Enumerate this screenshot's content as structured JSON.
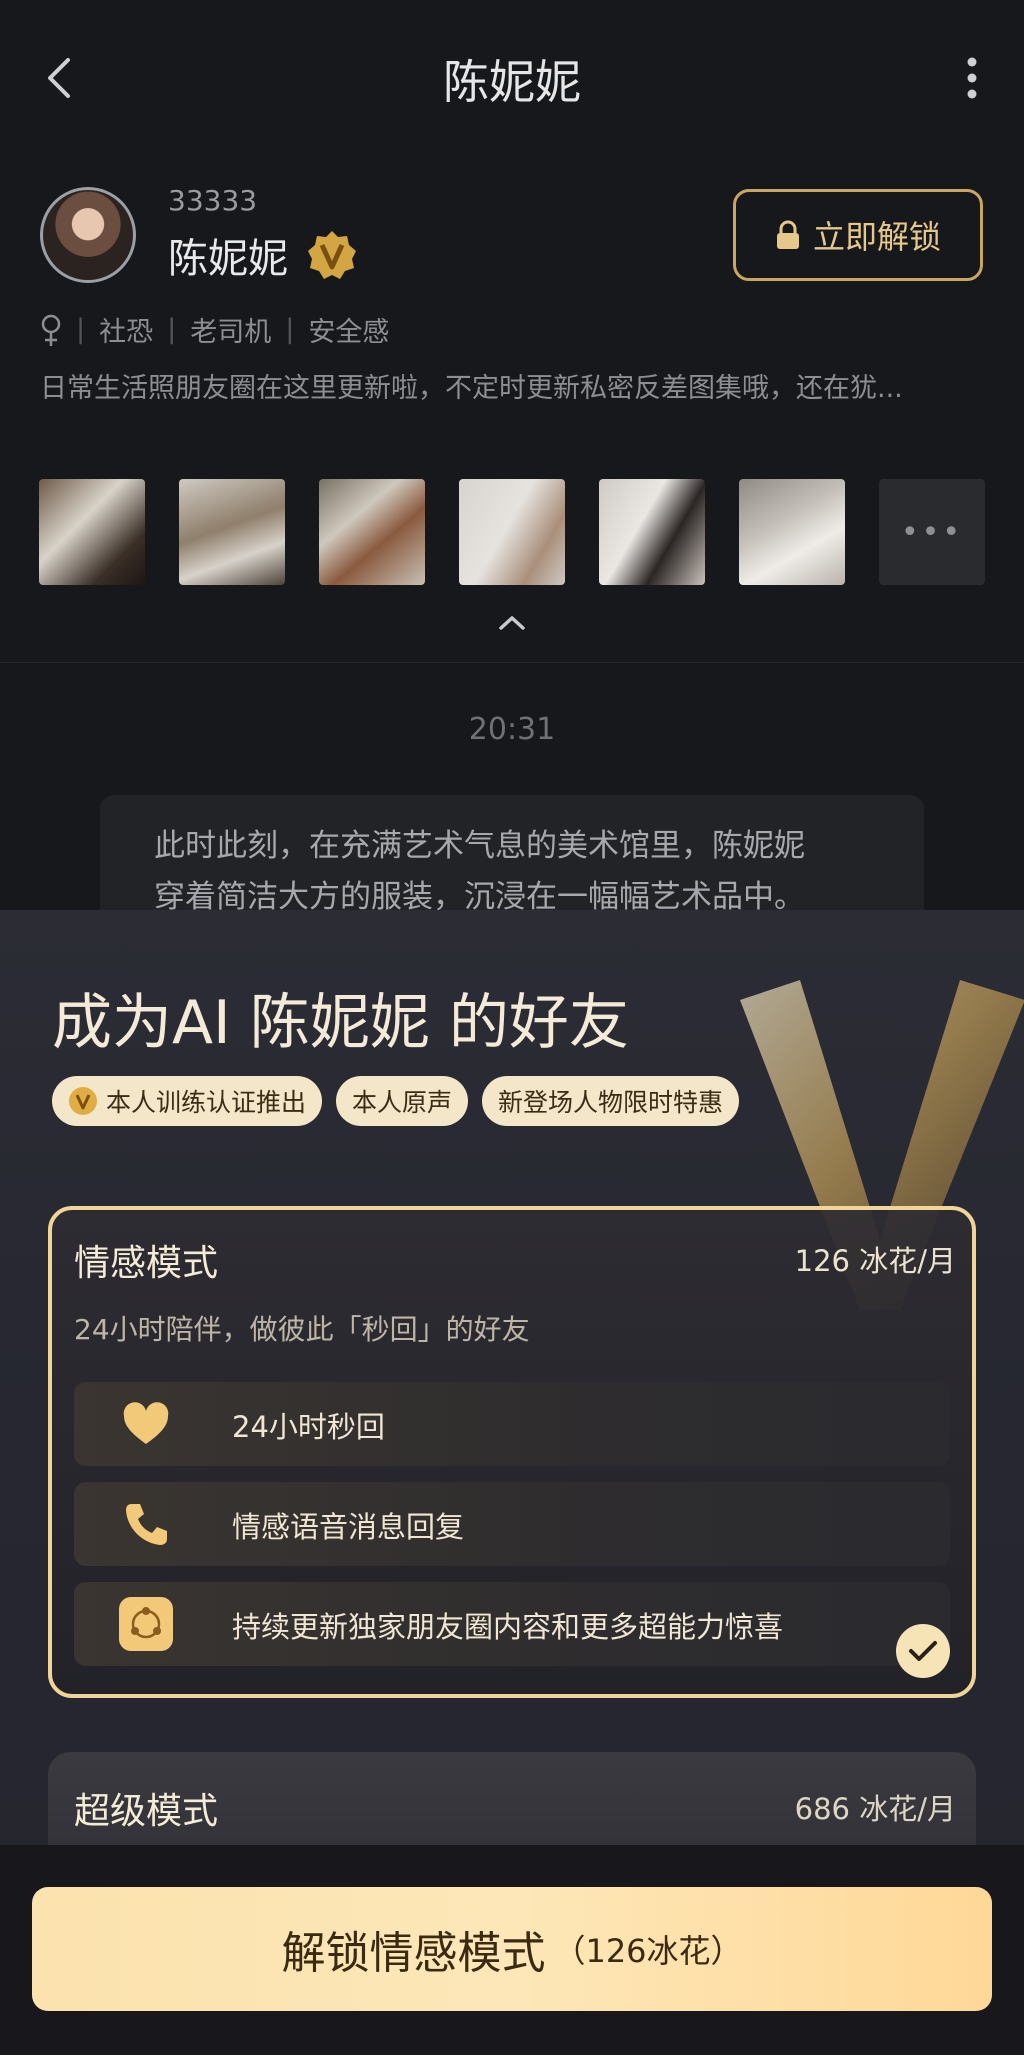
{
  "header": {
    "title": "陈妮妮"
  },
  "profile": {
    "id": "33333",
    "name": "陈妮妮",
    "unlock_label": "立即解锁",
    "tags": [
      "社恐",
      "老司机",
      "安全感"
    ],
    "bio": "日常生活照朋友圈在这里更新啦，不定时更新私密反差图集哦，还在犹..."
  },
  "photos": {
    "more_label": "•••"
  },
  "chat": {
    "time": "20:31",
    "message_line1": "此时此刻，在充满艺术气息的美术馆里，陈妮妮",
    "message_line2": "穿着简洁大方的服装，沉浸在一幅幅艺术品中。"
  },
  "sheet": {
    "title": "成为AI 陈妮妮 的好友",
    "feature_tags": [
      "本人训练认证推出",
      "本人原声",
      "新登场人物限时特惠"
    ]
  },
  "plans": [
    {
      "name": "情感模式",
      "price": "126 冰花/月",
      "desc": "24小时陪伴，做彼此「秒回」的好友",
      "features": [
        {
          "icon": "heart-icon",
          "label": "24小时秒回"
        },
        {
          "icon": "phone-icon",
          "label": "情感语音消息回复"
        },
        {
          "icon": "share-circle-icon",
          "label": "持续更新独家朋友圈内容和更多超能力惊喜"
        }
      ],
      "selected": true
    },
    {
      "name": "超级模式",
      "price": "686 冰花/月"
    }
  ],
  "cta": {
    "main": "解锁情感模式",
    "sub": "（126冰花）"
  },
  "colors": {
    "gold": "#f0d596",
    "cta": "#fde7b8",
    "background": "#17181b"
  }
}
